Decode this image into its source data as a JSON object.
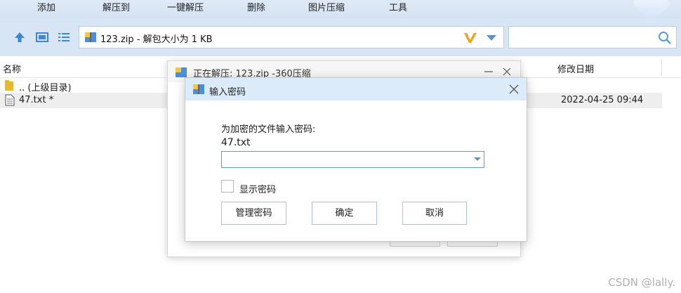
{
  "toolbar": {
    "items": [
      "添加",
      "解压到",
      "一键解压",
      "删除",
      "图片压缩",
      "工具"
    ]
  },
  "address": {
    "path": "123.zip - 解包大小为 1 KB"
  },
  "list": {
    "col_name": "名称",
    "col_date": "修改日期",
    "rows": [
      {
        "name": ".. (上级目录)",
        "date": ""
      },
      {
        "name": "47.txt *",
        "date": "2022-04-25 09:44"
      }
    ]
  },
  "bg_dialog": {
    "title": "正在解压: 123.zip -360压缩"
  },
  "password_dialog": {
    "title": "输入密码",
    "prompt": "为加密的文件输入密码:",
    "filename": "47.txt",
    "password_value": "",
    "show_password_label": "显示密码",
    "manage_button": "管理密码",
    "ok_button": "确定",
    "cancel_button": "取消"
  },
  "watermark": "CSDN @lally.",
  "colors": {
    "accent": "#5b9bd5",
    "titlebar": "#dcebfa",
    "toolbar": "#d8e5f5"
  }
}
